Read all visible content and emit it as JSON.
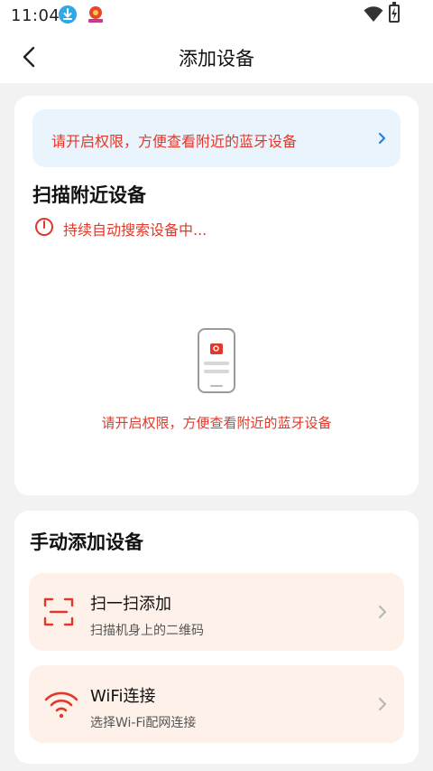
{
  "status_bar": {
    "time": "11:04",
    "icons": [
      "download-icon",
      "app-notification-icon",
      "wifi-icon",
      "battery-charging-icon"
    ]
  },
  "header": {
    "title": "添加设备",
    "back_icon": "back-chevron-icon"
  },
  "permission_banner": {
    "text": "请开启权限，方便查看附近的蓝牙设备",
    "arrow_icon": "chevron-right-icon"
  },
  "scan_section": {
    "title": "扫描附近设备",
    "status_text": "持续自动搜索设备中...",
    "empty_text": "请开启权限，方便查看附近的蓝牙设备"
  },
  "manual_section": {
    "title": "手动添加设备",
    "options": [
      {
        "label": "扫一扫添加",
        "sub": "扫描机身上的二维码",
        "icon": "scan-frame-icon"
      },
      {
        "label": "WiFi连接",
        "sub": "选择Wi-Fi配网连接",
        "icon": "wifi-icon"
      }
    ]
  },
  "colors": {
    "accent_red": "#e0392b",
    "banner_bg": "#eaf4fd",
    "option_bg": "#fdf1ea",
    "page_bg": "#f2f2f2"
  }
}
